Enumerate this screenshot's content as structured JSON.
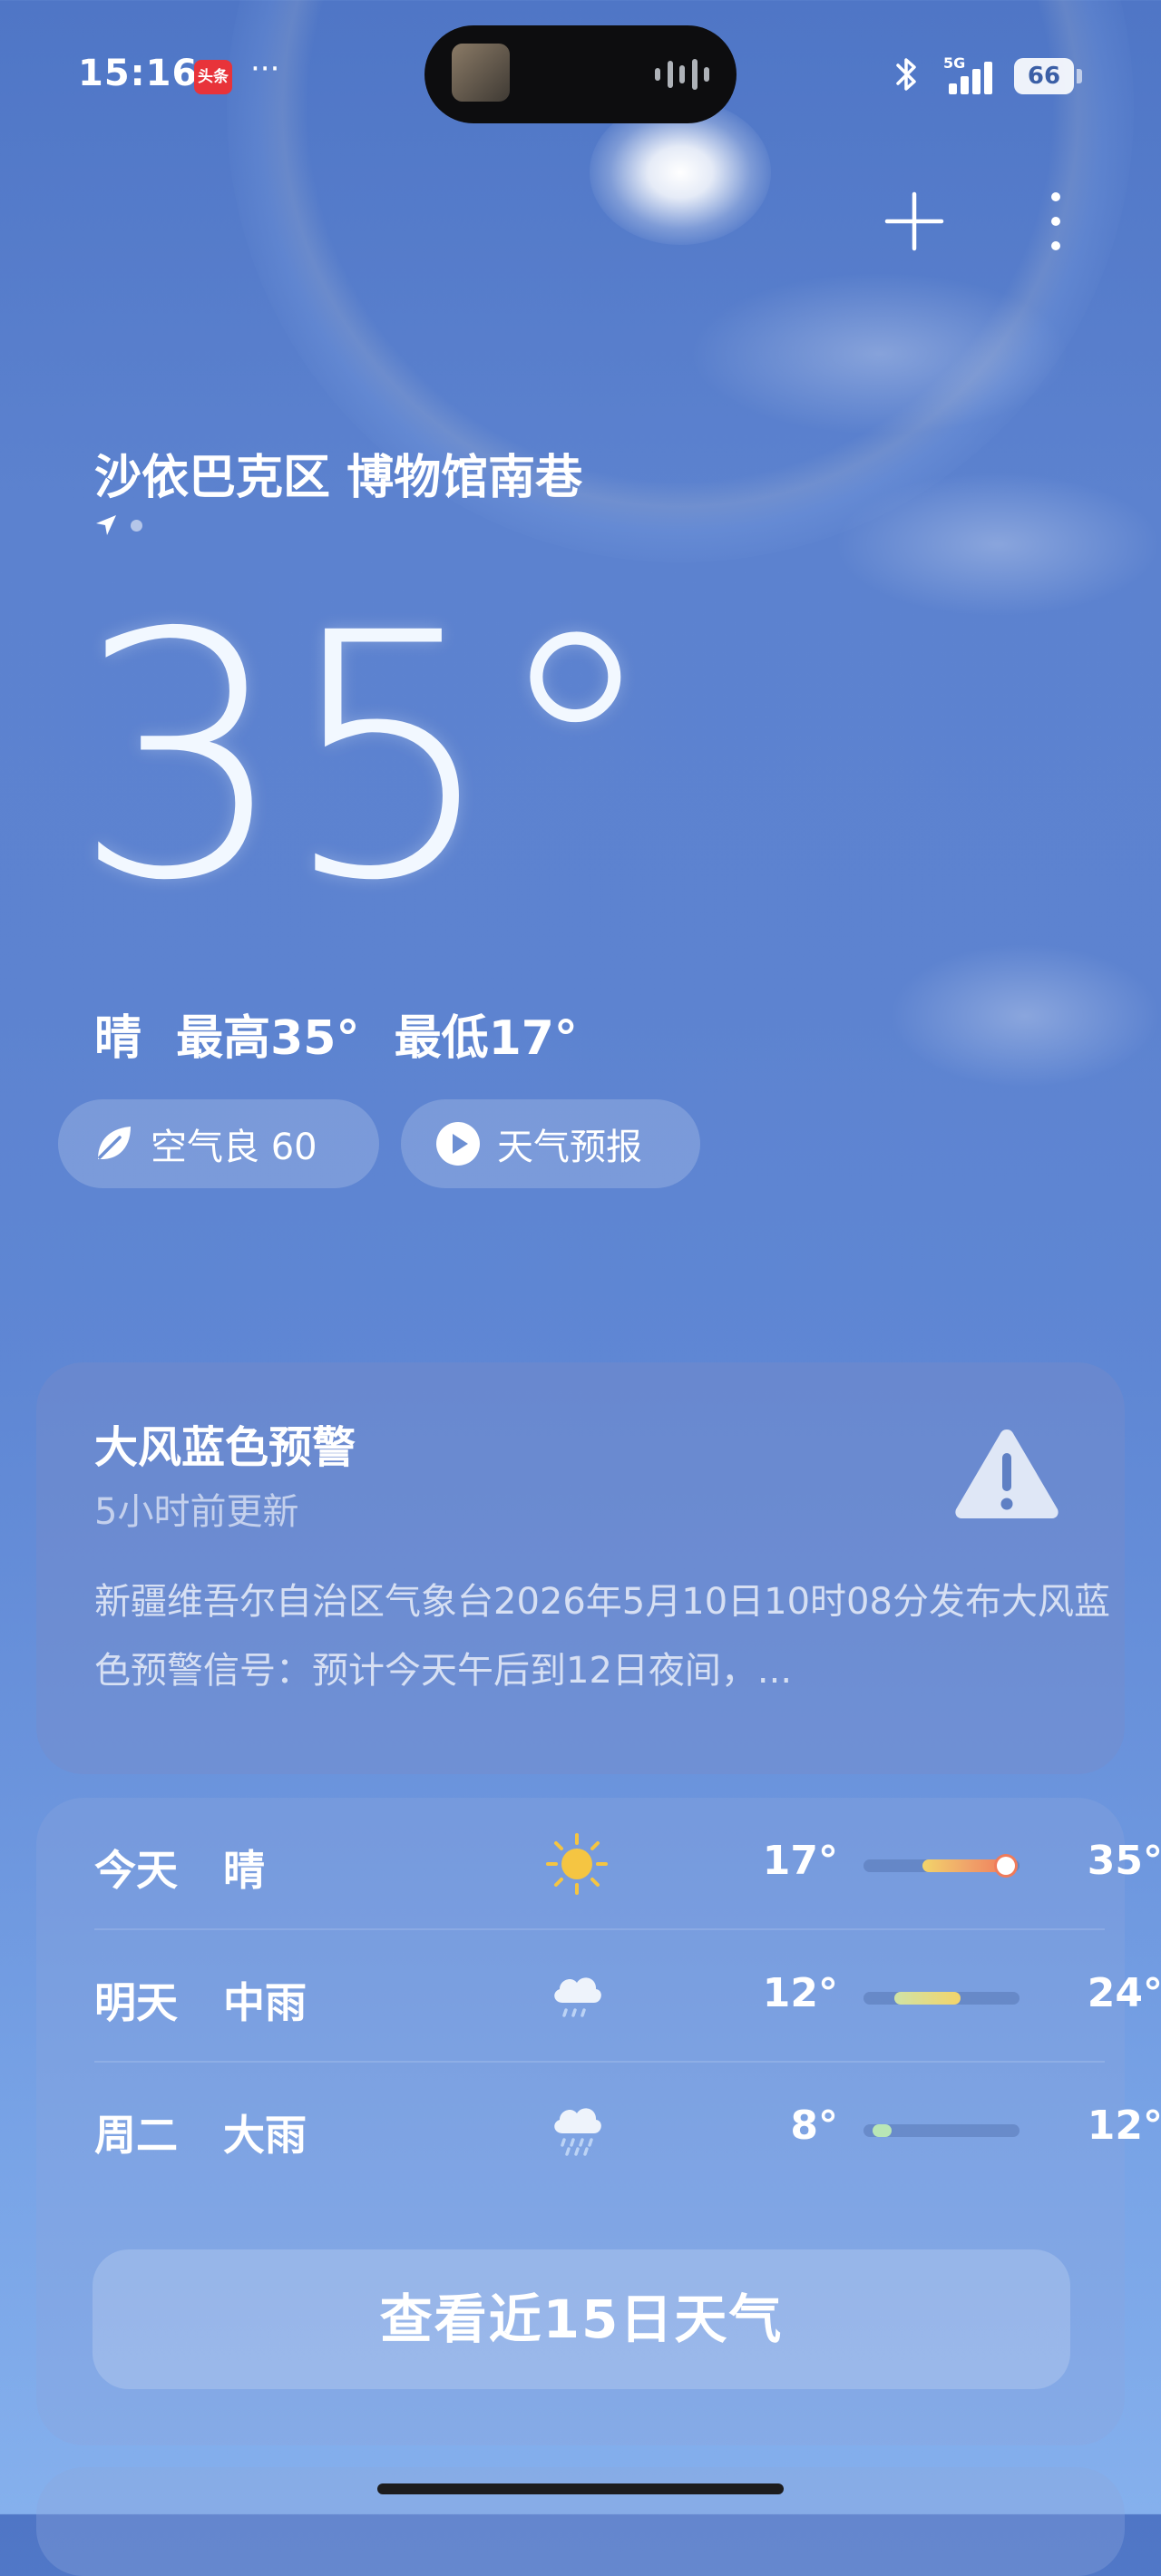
{
  "status_bar": {
    "time": "15:16",
    "app_badge": "头条",
    "more": "···",
    "network": "5G",
    "battery": "66"
  },
  "header": {
    "add_icon": "plus-icon",
    "more_icon": "more-vertical-icon"
  },
  "location": {
    "name": "沙依巴克区 博物馆南巷"
  },
  "current": {
    "temperature": "35°",
    "summary": "晴  最高35°  最低17°"
  },
  "chips": {
    "air_quality": "空气良 60",
    "forecast": "天气预报"
  },
  "warning": {
    "title": "大风蓝色预警",
    "updated": "5小时前更新",
    "body": "新疆维吾尔自治区气象台2026年5月10日10时08分发布大风蓝色预警信号：预计今天午后到12日夜间，...",
    "icon": "warning-triangle-icon"
  },
  "forecast": {
    "days": [
      {
        "day": "今天",
        "condition": "晴",
        "icon": "sunny-icon",
        "low": "17°",
        "high": "35°",
        "range": [
          0.38,
          0.94
        ],
        "color": "linear-gradient(90deg,#f3d46a,#f0a56a,#f07b5a)",
        "marker": true
      },
      {
        "day": "明天",
        "condition": "中雨",
        "icon": "rain-icon",
        "low": "12°",
        "high": "24°",
        "range": [
          0.2,
          0.62
        ],
        "color": "linear-gradient(90deg,#cfe3a6,#f3d46a)",
        "marker": false
      },
      {
        "day": "周二",
        "condition": "大雨",
        "icon": "heavy-rain-icon",
        "low": "8°",
        "high": "12°",
        "range": [
          0.06,
          0.18
        ],
        "color": "#b9e6b6",
        "marker": false
      }
    ],
    "button_label": "查看近15日天气"
  },
  "colors": {
    "accent_sun": "#f5c542",
    "warning_icon": "#dfe7f6"
  }
}
